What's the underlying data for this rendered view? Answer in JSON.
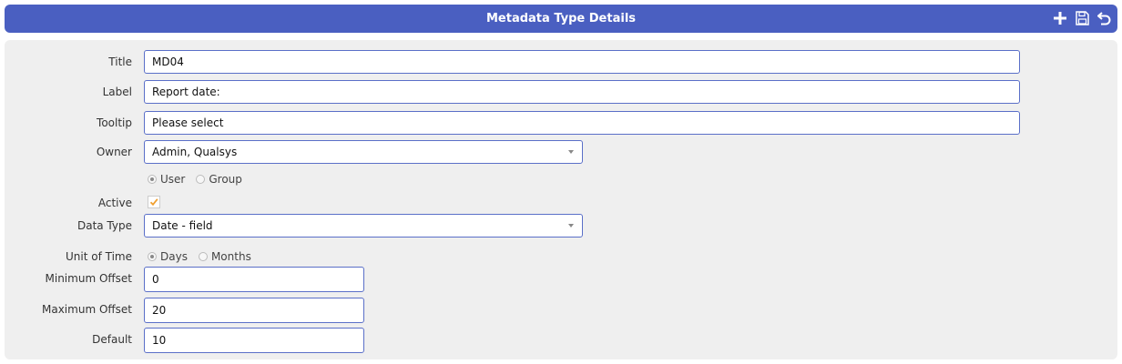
{
  "header": {
    "title": "Metadata Type Details"
  },
  "icons": {
    "add": "plus-icon",
    "save": "floppy-disk-icon",
    "undo": "undo-arrow-icon"
  },
  "colors": {
    "header_bg": "#4a5fc1",
    "field_border": "#5a6fc8",
    "checkbox_check": "#f0a030"
  },
  "form": {
    "title": {
      "label": "Title",
      "value": "MD04"
    },
    "label_field": {
      "label": "Label",
      "value": "Report date:"
    },
    "tooltip": {
      "label": "Tooltip",
      "value": "Please select"
    },
    "owner": {
      "label": "Owner",
      "value": "Admin, Qualsys"
    },
    "owner_type": {
      "options": [
        "User",
        "Group"
      ],
      "selected": "User"
    },
    "active": {
      "label": "Active",
      "checked": true
    },
    "data_type": {
      "label": "Data Type",
      "value": "Date - field"
    },
    "unit_of_time": {
      "label": "Unit of Time",
      "options": [
        "Days",
        "Months"
      ],
      "selected": "Days"
    },
    "minimum_offset": {
      "label": "Minimum Offset",
      "value": "0"
    },
    "maximum_offset": {
      "label": "Maximum Offset",
      "value": "20"
    },
    "default": {
      "label": "Default",
      "value": "10"
    }
  }
}
